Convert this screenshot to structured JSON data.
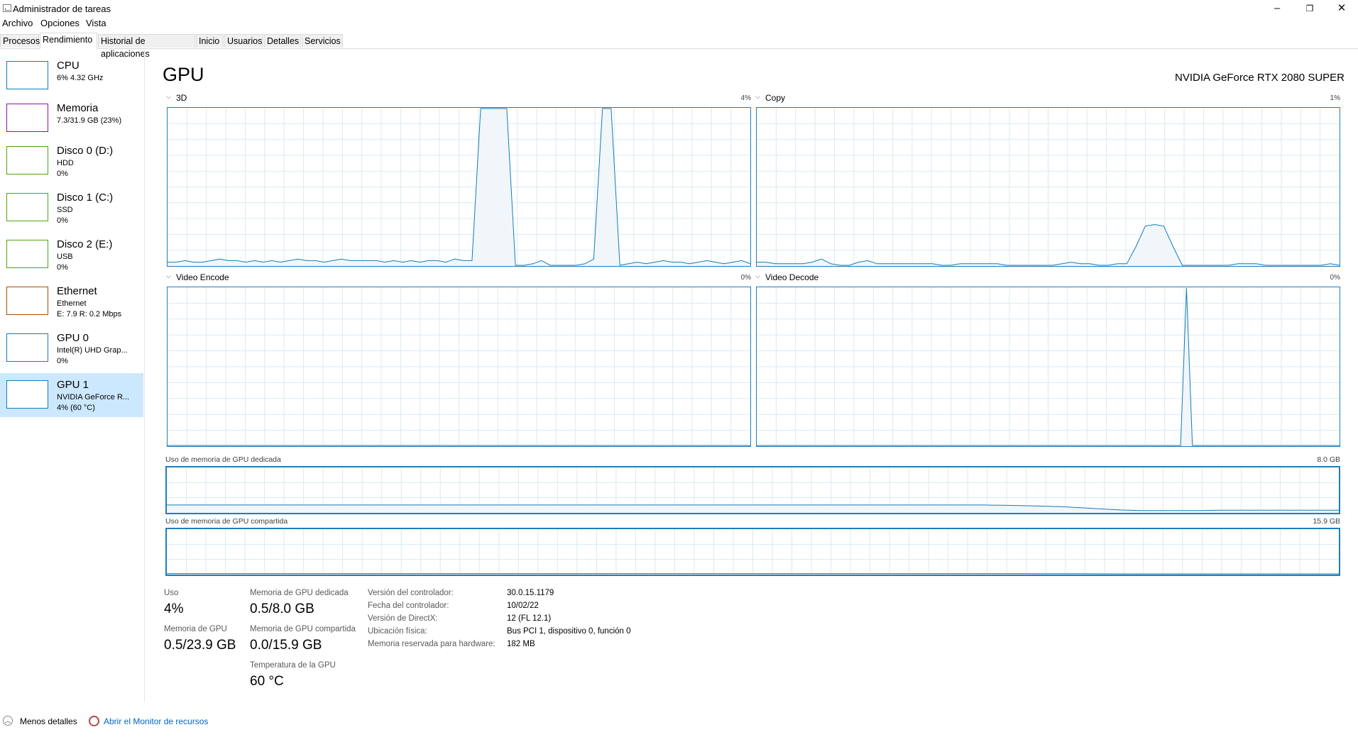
{
  "window": {
    "title": "Administrador de tareas",
    "minimize": "–",
    "restore": "❐",
    "close": "✕"
  },
  "menu": [
    "Archivo",
    "Opciones",
    "Vista"
  ],
  "tabs": [
    "Procesos",
    "Rendimiento",
    "Historial de aplicaciones",
    "Inicio",
    "Usuarios",
    "Detalles",
    "Servicios"
  ],
  "active_tab": "Rendimiento",
  "sidebar": {
    "items": [
      {
        "title": "CPU",
        "line1": "6%  4.32 GHz",
        "line2": "",
        "line3": "",
        "color": "#117dbb"
      },
      {
        "title": "Memoria",
        "line1": "7.3/31.9 GB (23%)",
        "line2": "",
        "line3": "",
        "color": "#8b12ae"
      },
      {
        "title": "Disco 0 (D:)",
        "line1": "HDD",
        "line2": "0%",
        "line3": "",
        "color": "#4da60c"
      },
      {
        "title": "Disco 1 (C:)",
        "line1": "SSD",
        "line2": "0%",
        "line3": "",
        "color": "#4da60c"
      },
      {
        "title": "Disco 2 (E:)",
        "line1": "USB",
        "line2": "0%",
        "line3": "",
        "color": "#4da60c"
      },
      {
        "title": "Ethernet",
        "line1": "Ethernet",
        "line2": "E: 7.9  R: 0.2 Mbps",
        "line3": "",
        "color": "#a74f01"
      },
      {
        "title": "GPU 0",
        "line1": "Intel(R) UHD Grap...",
        "line2": "0%",
        "line3": "",
        "color": "#117dbb"
      },
      {
        "title": "GPU 1",
        "line1": "NVIDIA GeForce R...",
        "line2": "4%  (60 °C)",
        "line3": "",
        "color": "#117dbb"
      }
    ],
    "selected_index": 7
  },
  "main": {
    "title": "GPU",
    "device_name": "NVIDIA GeForce RTX 2080 SUPER",
    "graphs": [
      {
        "label": "3D",
        "value": "4%",
        "values": [
          2,
          2,
          3,
          2,
          2,
          3,
          4,
          3,
          3,
          2,
          3,
          2,
          3,
          2,
          3,
          4,
          3,
          3,
          2,
          3,
          4,
          3,
          3,
          3,
          3,
          2,
          3,
          2,
          3,
          2,
          3,
          3,
          2,
          4,
          3,
          3,
          100,
          100,
          100,
          100,
          0,
          0,
          1,
          3,
          0,
          0,
          0,
          0,
          1,
          4,
          100,
          100,
          0,
          1,
          2,
          1,
          2,
          3,
          2,
          2,
          1,
          2,
          3,
          2,
          1,
          2,
          3,
          1
        ]
      },
      {
        "label": "Copy",
        "value": "1%",
        "values": [
          2,
          2,
          1,
          1,
          1,
          1,
          2,
          4,
          1,
          0,
          0,
          2,
          3,
          1,
          1,
          1,
          1,
          1,
          1,
          1,
          0,
          0,
          1,
          1,
          1,
          1,
          1,
          0,
          0,
          0,
          0,
          0,
          0,
          1,
          2,
          1,
          1,
          0,
          0,
          1,
          1,
          12,
          25,
          26,
          25,
          12,
          0,
          0,
          0,
          0,
          0,
          0,
          1,
          1,
          1,
          0,
          0,
          0,
          0,
          0,
          0,
          0,
          1,
          0
        ]
      },
      {
        "label": "Video Encode",
        "value": "0%",
        "values": [
          0,
          0,
          0,
          0,
          0,
          0,
          0,
          0,
          0,
          0,
          0,
          0,
          0,
          0,
          0,
          0,
          0,
          0,
          0,
          0,
          0,
          0,
          0,
          0,
          0,
          0,
          0,
          0,
          0,
          0
        ]
      },
      {
        "label": "Video Decode",
        "value": "0%",
        "values": [
          0,
          0,
          0,
          0,
          0,
          0,
          0,
          0,
          0,
          0,
          0,
          0,
          0,
          0,
          0,
          0,
          0,
          0,
          0,
          0,
          0,
          0,
          0,
          0,
          0,
          0,
          0,
          0,
          0,
          0,
          0,
          0,
          0,
          0,
          0,
          0,
          0,
          0,
          0,
          0,
          0,
          0,
          0,
          0,
          0,
          0,
          0,
          0,
          0,
          0,
          0,
          0,
          0,
          0,
          0,
          0,
          0,
          0,
          0,
          0,
          0,
          0,
          0,
          0,
          0,
          0,
          0,
          0,
          0,
          0,
          0,
          0,
          0,
          100,
          0,
          0,
          0,
          0,
          0,
          0,
          0,
          0,
          0,
          0,
          0,
          0,
          0,
          0,
          0,
          0,
          0,
          0,
          0,
          0,
          0,
          0,
          0,
          0,
          0,
          0
        ]
      }
    ],
    "memory_graphs": [
      {
        "label": "Uso de memoria de GPU dedicada",
        "value": "8.0 GB",
        "values": [
          1.3,
          1.3,
          1.3,
          1.3,
          1.3,
          1.3,
          1.3,
          1.3,
          1.3,
          1.3,
          1.3,
          1.3,
          1.3,
          1.3,
          1.3,
          1.3,
          1.3,
          1.3,
          1.3,
          1.3,
          1.3,
          1.3,
          1.3,
          1.3,
          1.3,
          1.3,
          1.3,
          1.3,
          1.3,
          1.3,
          1.3,
          1.3,
          1.3,
          1.3,
          1.3,
          1.3,
          1.3,
          1.3,
          1.3,
          1.3,
          1.3,
          1.3,
          1.25,
          1.2,
          1.1,
          1.0,
          0.8,
          0.6,
          0.4,
          0.3,
          0.3,
          0.3,
          0.3,
          0.35,
          0.35,
          0.35,
          0.35,
          0.35,
          0.35,
          0.35
        ]
      },
      {
        "label": "Uso de memoria de GPU compartida",
        "value": "15.9 GB",
        "values": [
          0.1,
          0.1,
          0.1,
          0.1,
          0.1,
          0.1,
          0.1,
          0.1,
          0.1,
          0.1,
          0.1,
          0.1,
          0.1,
          0.1,
          0.1,
          0.1,
          0.1,
          0.1,
          0.1,
          0.1,
          0.1,
          0.1,
          0.1,
          0.1,
          0.1,
          0.1,
          0.1,
          0.1,
          0.1,
          0.1,
          0.1,
          0.1,
          0.1,
          0.1,
          0.1,
          0.1,
          0.1,
          0.1,
          0.1,
          0.1,
          0.1,
          0.1,
          0.1,
          0.1,
          0.08,
          0.06,
          0.04,
          0.02,
          0.01,
          0.01,
          0.01,
          0.01,
          0.01,
          0.01,
          0.01,
          0.01,
          0.01,
          0.01,
          0.01,
          0.01
        ]
      }
    ],
    "stats": {
      "uso_label": "Uso",
      "uso_value": "4%",
      "dedicated_label": "Memoria de GPU dedicada",
      "dedicated_value": "0.5/8.0 GB",
      "gpu_mem_label": "Memoria de GPU",
      "gpu_mem_value": "0.5/23.9 GB",
      "shared_label": "Memoria de GPU compartida",
      "shared_value": "0.0/15.9 GB",
      "temp_label": "Temperatura de la GPU",
      "temp_value": "60 °C"
    },
    "info": [
      {
        "key": "Versión del controlador:",
        "value": "30.0.15.1179"
      },
      {
        "key": "Fecha del controlador:",
        "value": "10/02/22"
      },
      {
        "key": "Versión de DirectX:",
        "value": "12 (FL 12.1)"
      },
      {
        "key": "Ubicación física:",
        "value": "Bus PCI 1, dispositivo 0, función 0"
      },
      {
        "key": "Memoria reservada para hardware:",
        "value": "182 MB"
      }
    ]
  },
  "footer": {
    "fewer_details": "Menos detalles",
    "resource_monitor": "Abrir el Monitor de recursos"
  },
  "colors": {
    "graph_line": "#117dbb",
    "graph_fill": "#f1f6fa",
    "grid": "#d9eaf4",
    "selected": "#cce8ff",
    "link": "#0066cc"
  }
}
